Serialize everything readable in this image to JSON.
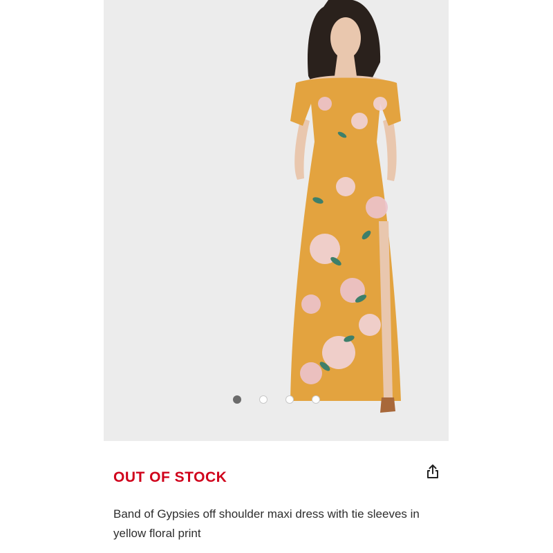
{
  "product": {
    "stock_status": "OUT OF STOCK",
    "title": "Band of Gypsies off shoulder maxi dress with tie sleeves in yellow floral print",
    "image_count": 4,
    "active_image": 1
  },
  "icons": {
    "share": "share-icon"
  },
  "colors": {
    "stock_status": "#d0021b",
    "image_background": "#ececec",
    "dress": "#e3a33f",
    "active_dot": "#6b6b6b"
  }
}
